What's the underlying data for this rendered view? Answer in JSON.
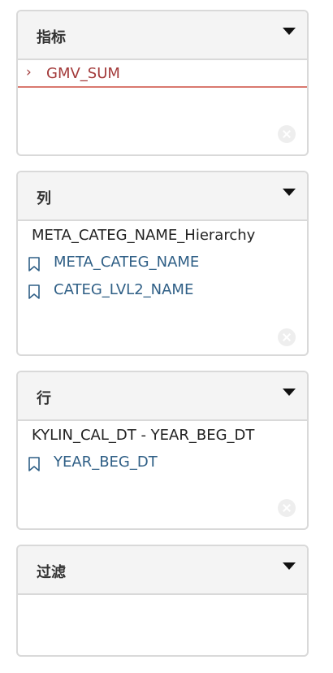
{
  "panels": {
    "measures": {
      "title": "指标",
      "items": [
        {
          "label": "GMV_SUM"
        }
      ]
    },
    "columns": {
      "title": "列",
      "hierarchy": "META_CATEG_NAME_Hierarchy",
      "levels": [
        {
          "label": "META_CATEG_NAME"
        },
        {
          "label": "CATEG_LVL2_NAME"
        }
      ]
    },
    "rows": {
      "title": "行",
      "hierarchy": "KYLIN_CAL_DT - YEAR_BEG_DT",
      "levels": [
        {
          "label": "YEAR_BEG_DT"
        }
      ]
    },
    "filter": {
      "title": "过滤"
    }
  },
  "icons": {
    "dropdown": "caret-down-icon",
    "expand": "chevron-right-icon",
    "level": "bookmark-icon",
    "remove": "remove-circle-icon"
  },
  "colors": {
    "measure_text": "#a33a3a",
    "measure_underline": "#d9796f",
    "level_text": "#2f5f86",
    "header_bg": "#f4f4f4",
    "border": "#d9d9d9"
  }
}
